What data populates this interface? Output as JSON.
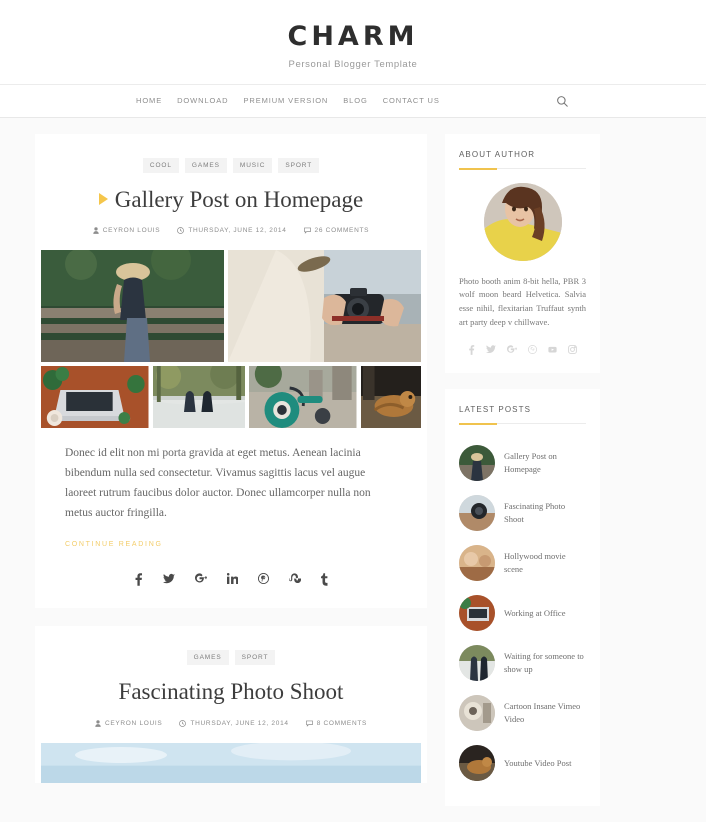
{
  "site": {
    "logo": "CHARM",
    "tagline": "Personal Blogger Template"
  },
  "nav": {
    "items": [
      {
        "label": "HOME"
      },
      {
        "label": "DOWNLOAD"
      },
      {
        "label": "PREMIUM VERSION"
      },
      {
        "label": "BLOG"
      },
      {
        "label": "CONTACT US"
      }
    ],
    "search_icon": "search-icon"
  },
  "posts": [
    {
      "categories": [
        "COOL",
        "GAMES",
        "MUSIC",
        "SPORT"
      ],
      "title": "Gallery Post on Homepage",
      "has_play_icon": true,
      "author": "CEYRON LOUIS",
      "date": "THURSDAY, JUNE 12, 2014",
      "comments": "26 COMMENTS",
      "excerpt": "Donec id elit non mi porta gravida at eget metus. Aenean lacinia bibendum nulla sed consectetur. Vivamus sagittis lacus vel augue laoreet rutrum faucibus dolor auctor. Donec ullamcorper nulla non metus auctor fringilla.",
      "continue_label": "CONTINUE READING",
      "share_icons": [
        "facebook-icon",
        "twitter-icon",
        "google-plus-icon",
        "linkedin-icon",
        "pinterest-icon",
        "stumbleupon-icon",
        "tumblr-icon"
      ]
    },
    {
      "categories": [
        "GAMES",
        "SPORT"
      ],
      "title": "Fascinating Photo Shoot",
      "has_play_icon": false,
      "author": "CEYRON LOUIS",
      "date": "THURSDAY, JUNE 12, 2014",
      "comments": "8 COMMENTS"
    }
  ],
  "sidebar": {
    "about": {
      "title": "ABOUT AUTHOR",
      "bio": "Photo booth anim 8-bit hella, PBR 3 wolf moon beard Helvetica. Salvia esse nihil, flexitarian Truffaut synth art party deep v chillwave.",
      "social_icons": [
        "facebook-icon",
        "twitter-icon",
        "google-plus-icon",
        "pinterest-icon",
        "youtube-icon",
        "instagram-icon"
      ]
    },
    "latest": {
      "title": "LATEST POSTS",
      "items": [
        {
          "title": "Gallery Post on Homepage"
        },
        {
          "title": "Fascinating Photo Shoot"
        },
        {
          "title": "Hollywood movie scene"
        },
        {
          "title": "Working at Office"
        },
        {
          "title": "Waiting for someone to show up"
        },
        {
          "title": "Cartoon Insane Vimeo Video"
        },
        {
          "title": "Youtube Video Post"
        }
      ]
    }
  },
  "colors": {
    "accent": "#f0c34e",
    "page_bg": "#fafafa",
    "card_bg": "#ffffff",
    "text": "#444444"
  }
}
